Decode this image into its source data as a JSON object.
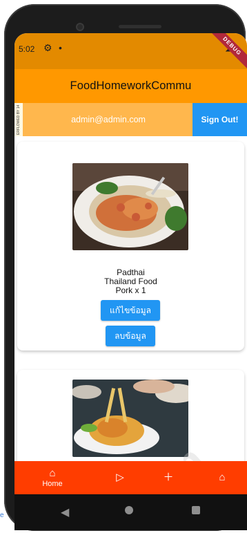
{
  "status_bar": {
    "time": "5:02",
    "gear_icon": "gear-icon",
    "dot": "•",
    "signal_icon": "signal-icon",
    "debug_label": "DEBUG"
  },
  "app_bar": {
    "title": "FoodHomeworkCommu"
  },
  "user_bar": {
    "banner_tag": "ERFLOWED BY 14",
    "email": "admin@admin.com",
    "sign_out_label": "Sign Out!"
  },
  "foods": [
    {
      "name": "Padthai",
      "type": "Thailand Food",
      "meat": "Pork x 1",
      "edit_label": "แก้ไขข้อมูล",
      "delete_label": "ลบข้อมูล"
    }
  ],
  "watermark": "Dem",
  "bottom_nav": {
    "home_label": "Home",
    "icons": [
      "home-icon",
      "play-icon",
      "add-icon",
      "store-icon"
    ]
  },
  "colors": {
    "app_bar": "#ff9800",
    "status_bar": "#e38a00",
    "user_bar": "#ffb74d",
    "sign_out": "#2196f3",
    "bottom_nav": "#ff3d00"
  }
}
